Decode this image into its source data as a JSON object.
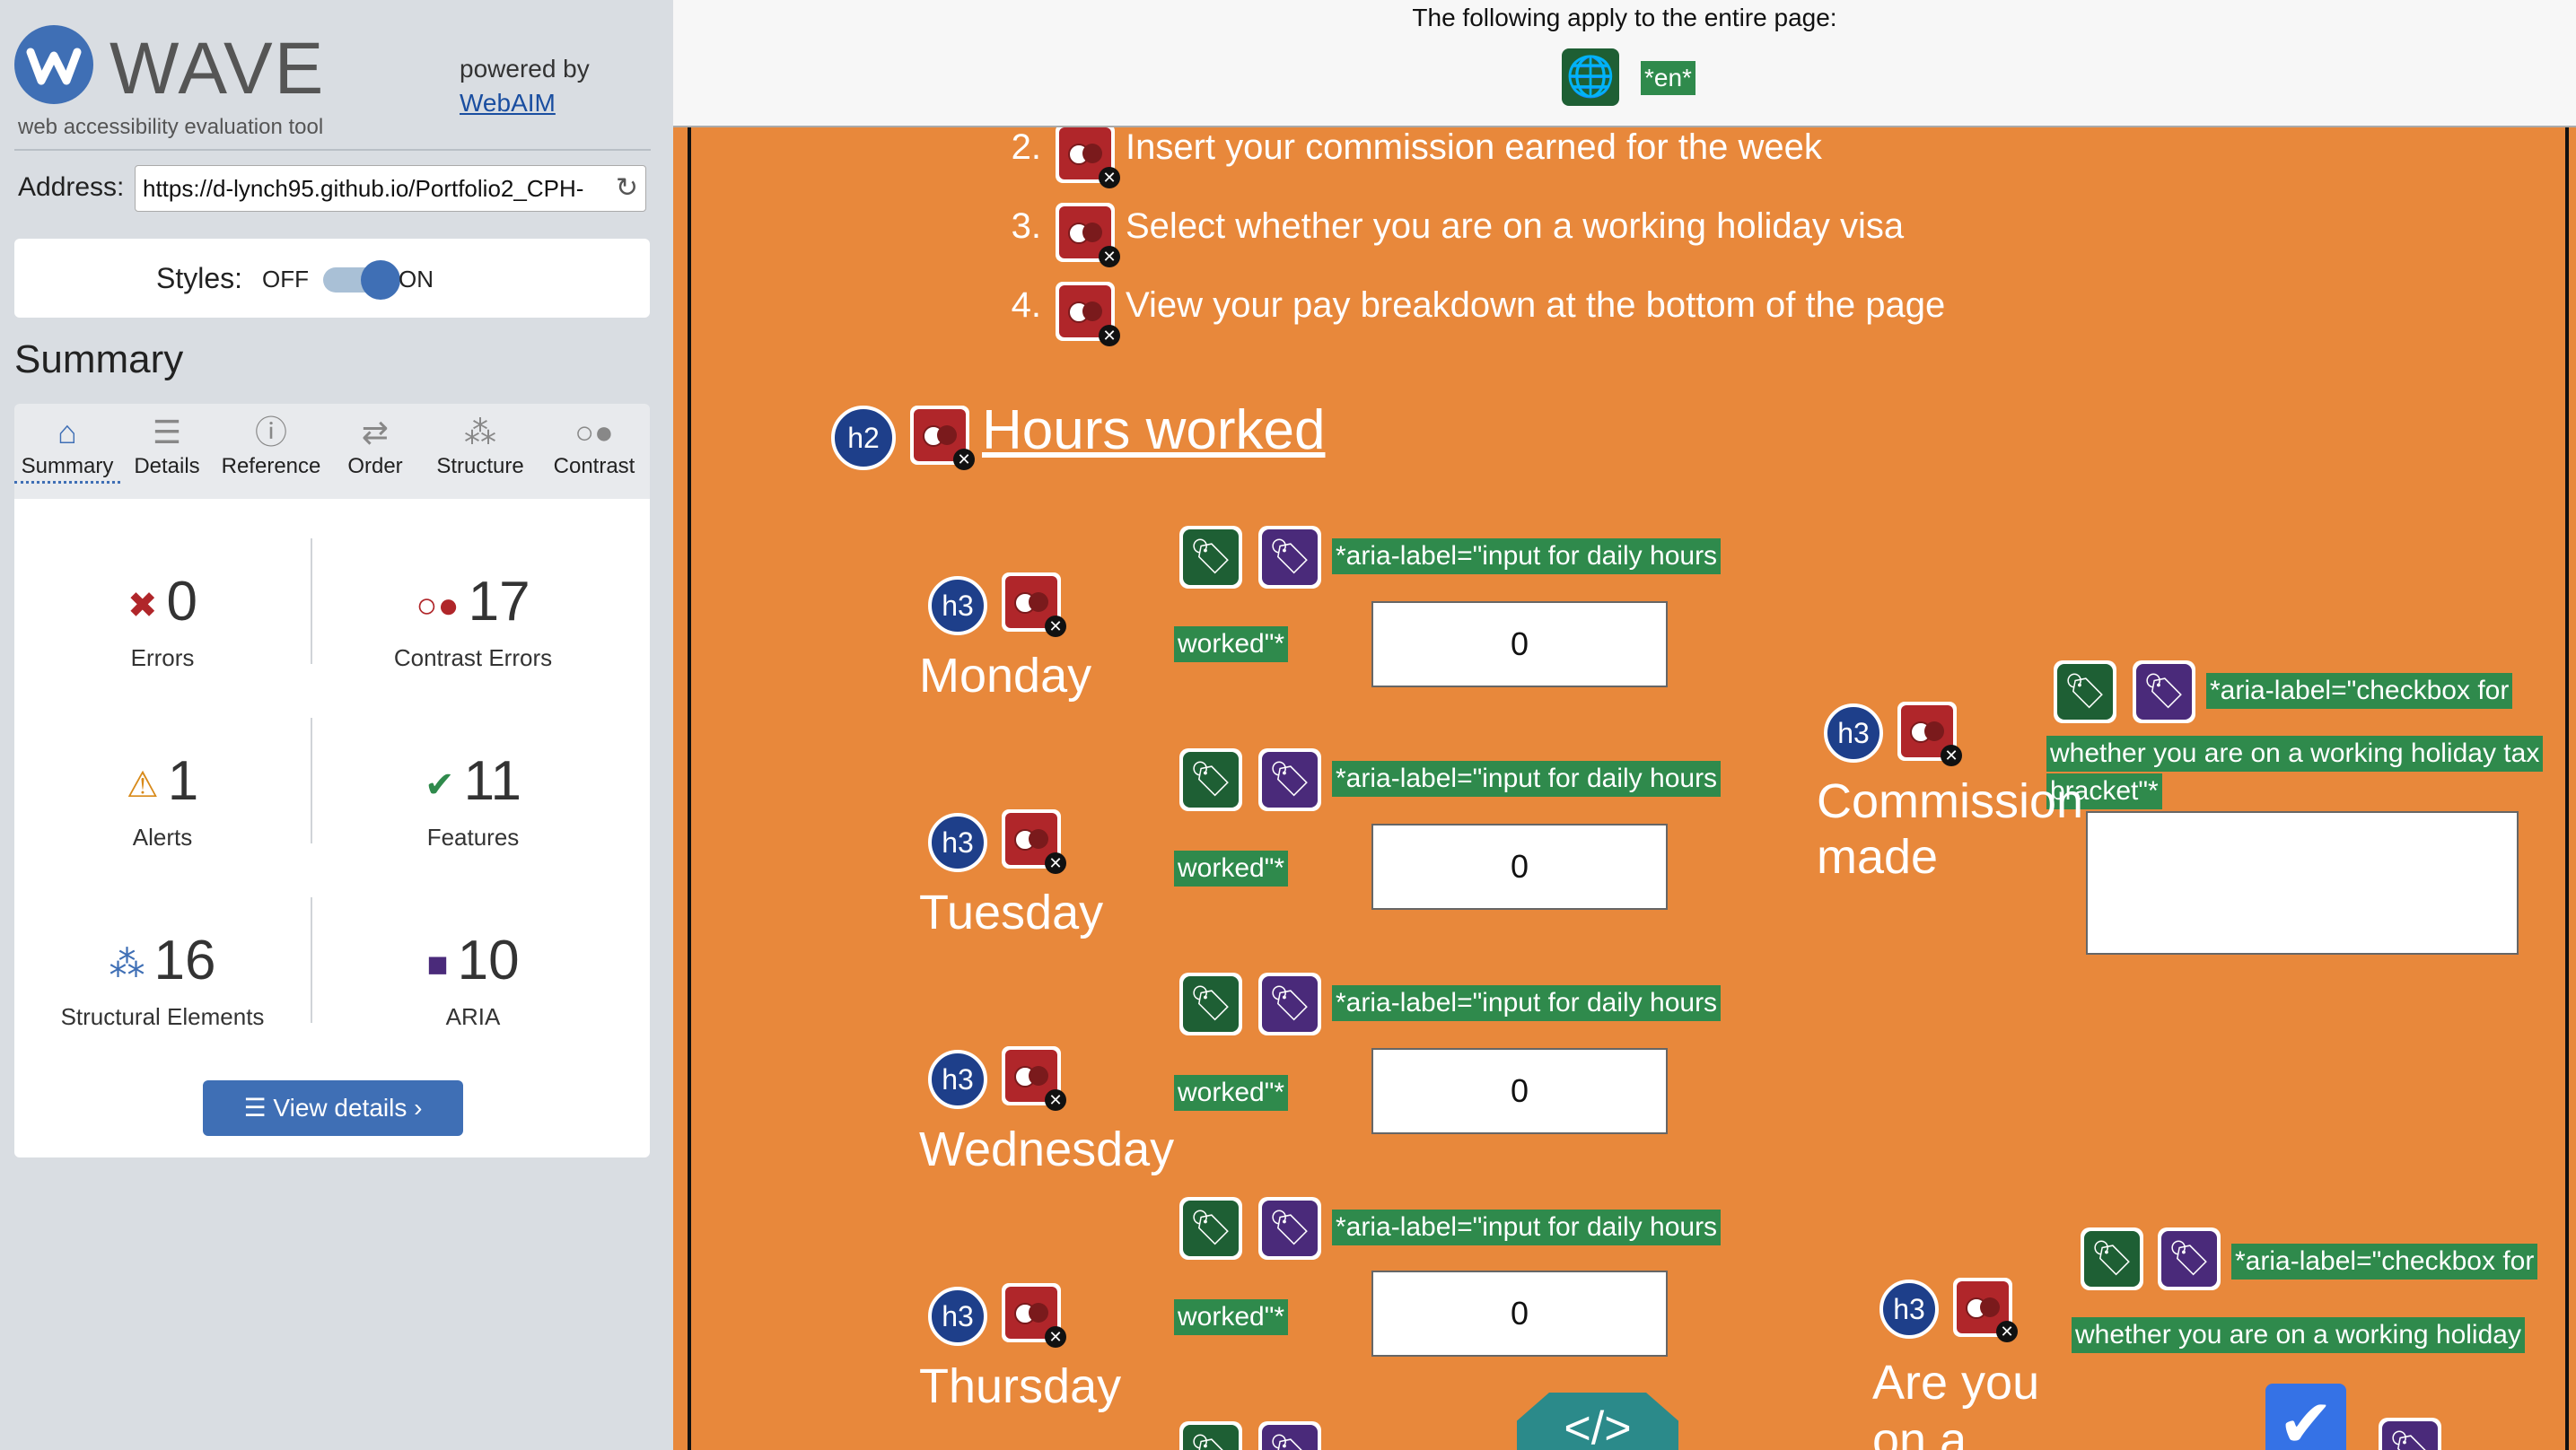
{
  "sidebar": {
    "logo_word": "WAVE",
    "logo_tagline": "web accessibility evaluation tool",
    "powered_by": "powered by",
    "powered_link": "WebAIM",
    "address_label": "Address:",
    "address_value": "https://d-lynch95.github.io/Portfolio2_CPH-",
    "reload_icon": "↻",
    "styles_label": "Styles:",
    "styles_off": "OFF",
    "styles_on": "ON",
    "summary_title": "Summary",
    "tabs": [
      {
        "label": "Summary",
        "icon": "home-icon",
        "glyph": "⌂"
      },
      {
        "label": "Details",
        "icon": "list-icon",
        "glyph": "☰"
      },
      {
        "label": "Reference",
        "icon": "info-icon",
        "glyph": "ⓘ"
      },
      {
        "label": "Order",
        "icon": "order-icon",
        "glyph": "⇄"
      },
      {
        "label": "Structure",
        "icon": "structure-icon",
        "glyph": "⁂"
      },
      {
        "label": "Contrast",
        "icon": "contrast-icon",
        "glyph": "○●"
      }
    ],
    "stats": {
      "errors": {
        "count": "0",
        "label": "Errors",
        "glyph": "✖"
      },
      "contrast_errors": {
        "count": "17",
        "label": "Contrast Errors",
        "glyph": "○●"
      },
      "alerts": {
        "count": "1",
        "label": "Alerts",
        "glyph": "⚠"
      },
      "features": {
        "count": "11",
        "label": "Features",
        "glyph": "✔"
      },
      "structural": {
        "count": "16",
        "label": "Structural Elements",
        "glyph": "⁂"
      },
      "aria": {
        "count": "10",
        "label": "ARIA",
        "glyph": "■"
      }
    },
    "view_details": "☰  View details ›"
  },
  "topbar": {
    "text": "The following apply to the entire page:",
    "globe_glyph": "🌐",
    "lang_tag": "*en*"
  },
  "content": {
    "steps": [
      {
        "num": "2.",
        "text": "Insert your commission earned for the week"
      },
      {
        "num": "3.",
        "text": "Select whether you are on a working holiday visa"
      },
      {
        "num": "4.",
        "text": "View your pay breakdown at the bottom of the page"
      }
    ],
    "h2_badge": "h2",
    "h2_title": "Hours worked",
    "h3_badge": "h3",
    "days": [
      "Monday",
      "Tuesday",
      "Wednesday",
      "Thursday"
    ],
    "aria_daily_1": "*aria-label=\"input for daily hours",
    "aria_daily_2": "worked\"*",
    "input_values": [
      "0",
      "0",
      "0",
      "0"
    ],
    "commission_title_1": "Commission",
    "commission_title_2": "made",
    "aria_commission_1": "*aria-label=\"checkbox for",
    "aria_commission_2": "whether you are on a working holiday tax",
    "aria_commission_3": "bracket\"*",
    "areyou_title_1": "Are you",
    "areyou_title_2": "on a",
    "aria_holiday_1": "*aria-label=\"checkbox for",
    "aria_holiday_2": "whether you are on a working holiday",
    "tag_glyph": "🏷",
    "check_glyph": "✔",
    "code_glyph": "</>"
  }
}
